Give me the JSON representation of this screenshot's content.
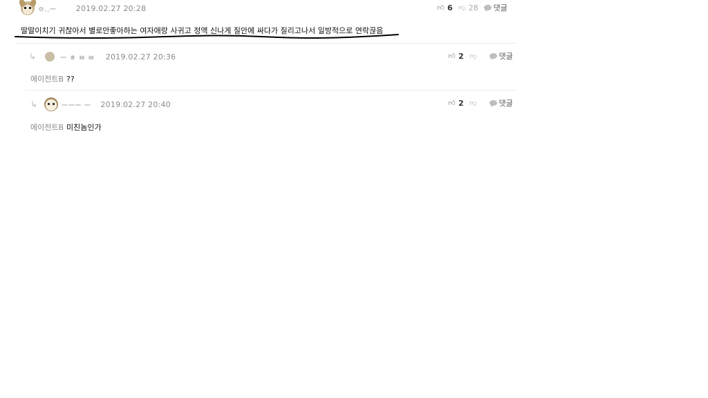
{
  "comments": [
    {
      "nickname": "ㅇ..ㅡ",
      "date": "2019.02.27 20:28",
      "likes": "6",
      "dislikes": "28",
      "reply_label": "댓글",
      "text": "딸딸이치기 귀찮아서 별로안좋아하는 여자애랑 사귀고 정액 신나게 질안에 싸다가 질리고나서 일방적으로 연락끊음"
    },
    {
      "nickname": "ㅡ ㅎ ㅂ ㅂ",
      "date": "2019.02.27 20:36",
      "likes": "2",
      "dislikes": "",
      "reply_label": "댓글",
      "mention": "에이전트B",
      "text": "??"
    },
    {
      "nickname": "ㅡㅡㅡ ㅡ",
      "date": "2019.02.27 20:40",
      "likes": "2",
      "dislikes": "",
      "reply_label": "댓글",
      "mention": "에이전트B",
      "text": "미친놈인가"
    }
  ],
  "icons": {
    "reply_arrow": "reply-arrow-icon",
    "like": "thumbs-up-icon",
    "dislike": "thumbs-down-icon",
    "reply": "speech-bubble-icon"
  },
  "colors": {
    "underline": "#000000",
    "date": "#8a8a8a",
    "mention": "#8a8a8a"
  }
}
